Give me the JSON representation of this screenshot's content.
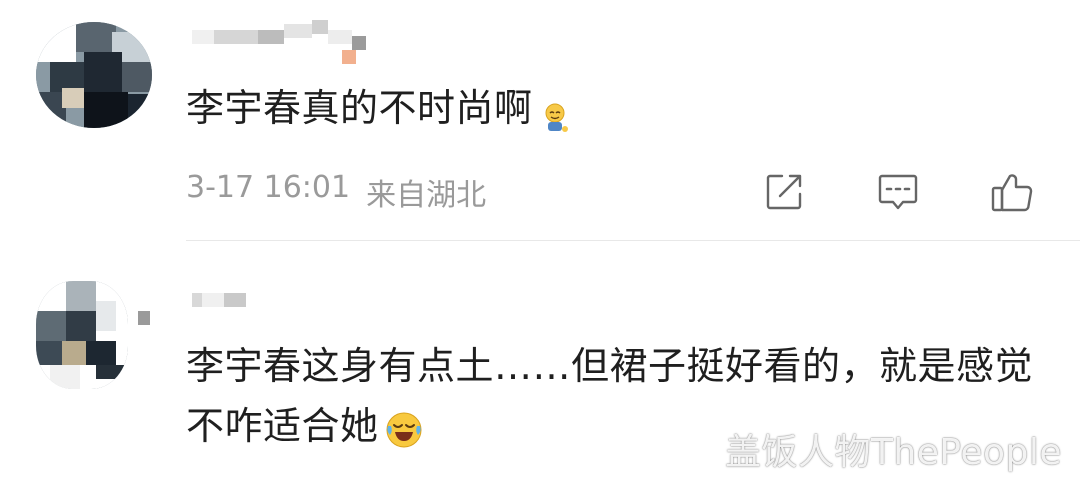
{
  "comments": [
    {
      "text": "李宇春真的不时尚啊",
      "emoji_icon": "smiling-figure-emoji",
      "time": "3-17 16:01",
      "location": "来自湖北"
    },
    {
      "text": "李宇春这身有点土……但裙子挺好看的，就是感觉不咋适合她",
      "emoji_icon": "laugh-cry-emoji"
    }
  ],
  "watermark": "盖饭人物ThePeople",
  "colors": {
    "meta_text": "#9a9a9a",
    "icon_stroke": "#666666",
    "divider": "#e8e8e8"
  }
}
